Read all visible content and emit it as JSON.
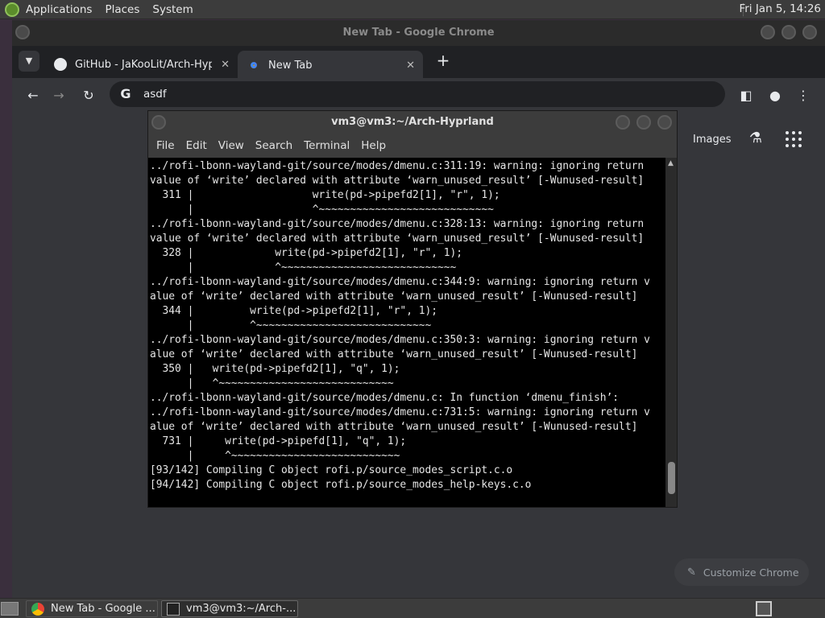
{
  "top_panel": {
    "menus": [
      "Applications",
      "Places",
      "System"
    ],
    "clock": "Fri Jan 5, 14:26"
  },
  "chrome": {
    "window_title": "New Tab - Google Chrome",
    "tabs": [
      {
        "title": "GitHub - JaKooLit/Arch-Hyprl",
        "icon": "github-icon"
      },
      {
        "title": "New Tab",
        "icon": "chrome-icon"
      }
    ],
    "omnibox_value": "asdf",
    "ntp": {
      "images_link": "Images",
      "customize_label": "Customize Chrome"
    }
  },
  "terminal": {
    "title": "vm3@vm3:~/Arch-Hyprland",
    "menu": [
      "File",
      "Edit",
      "View",
      "Search",
      "Terminal",
      "Help"
    ],
    "lines": [
      "../rofi-lbonn-wayland-git/source/modes/dmenu.c:311:19: warning: ignoring return",
      "value of ‘write’ declared with attribute ‘warn_unused_result’ [-Wunused-result]",
      "  311 |                   write(pd->pipefd2[1], \"r\", 1);",
      "      |                   ^~~~~~~~~~~~~~~~~~~~~~~~~~~~~",
      "../rofi-lbonn-wayland-git/source/modes/dmenu.c:328:13: warning: ignoring return",
      "value of ‘write’ declared with attribute ‘warn_unused_result’ [-Wunused-result]",
      "  328 |             write(pd->pipefd2[1], \"r\", 1);",
      "      |             ^~~~~~~~~~~~~~~~~~~~~~~~~~~~~",
      "../rofi-lbonn-wayland-git/source/modes/dmenu.c:344:9: warning: ignoring return v",
      "alue of ‘write’ declared with attribute ‘warn_unused_result’ [-Wunused-result]",
      "  344 |         write(pd->pipefd2[1], \"r\", 1);",
      "      |         ^~~~~~~~~~~~~~~~~~~~~~~~~~~~~",
      "../rofi-lbonn-wayland-git/source/modes/dmenu.c:350:3: warning: ignoring return v",
      "alue of ‘write’ declared with attribute ‘warn_unused_result’ [-Wunused-result]",
      "  350 |   write(pd->pipefd2[1], \"q\", 1);",
      "      |   ^~~~~~~~~~~~~~~~~~~~~~~~~~~~~",
      "../rofi-lbonn-wayland-git/source/modes/dmenu.c: In function ‘dmenu_finish’:",
      "../rofi-lbonn-wayland-git/source/modes/dmenu.c:731:5: warning: ignoring return v",
      "alue of ‘write’ declared with attribute ‘warn_unused_result’ [-Wunused-result]",
      "  731 |     write(pd->pipefd[1], \"q\", 1);",
      "      |     ^~~~~~~~~~~~~~~~~~~~~~~~~~~~",
      "[93/142] Compiling C object rofi.p/source_modes_script.c.o",
      "[94/142] Compiling C object rofi.p/source_modes_help-keys.c.o"
    ]
  },
  "taskbar": {
    "tasks": [
      {
        "label": "New Tab - Google ...",
        "icon": "chrome-icon"
      },
      {
        "label": "vm3@vm3:~/Arch-...",
        "icon": "terminal-icon"
      }
    ]
  }
}
